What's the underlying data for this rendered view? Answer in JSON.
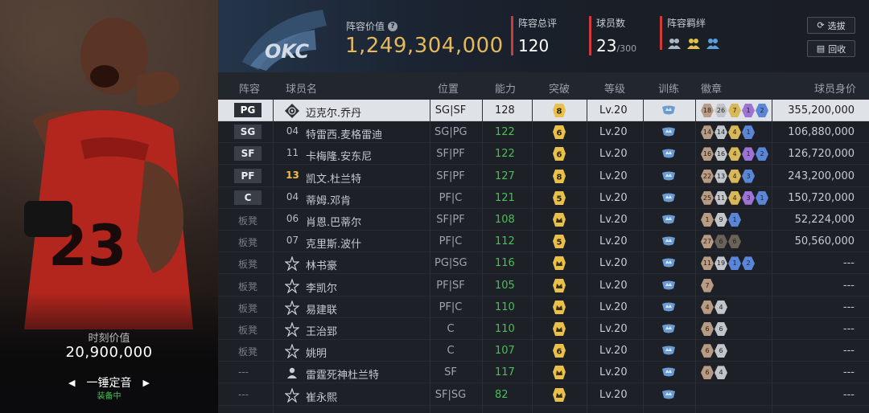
{
  "card": {
    "moment_label": "时刻价值",
    "moment_value": "20,900,000",
    "name": "一锤定音",
    "status": "装备中"
  },
  "header": {
    "lineup_value_label": "阵容价值",
    "lineup_value": "1,249,304,000",
    "rating_label": "阵容总评",
    "rating_value": "120",
    "count_label": "球员数",
    "count_value": "23",
    "count_max": "/300",
    "bond_label": "阵容羁绊",
    "bond_colors": [
      "#a9b6c6",
      "#e2c04a",
      "#5aa0e0"
    ],
    "btn_select": "选拔",
    "btn_recycle": "回收",
    "team_logo_text": "OKC"
  },
  "columns": [
    "阵容",
    "球员名",
    "位置",
    "能力",
    "突破",
    "等级",
    "训练",
    "徽章",
    "球员身价"
  ],
  "rows": [
    {
      "lineup": "PG",
      "starter": true,
      "icon": "clover",
      "num": "",
      "name": "迈克尔.乔丹",
      "pos": "SG|SF",
      "ability": "128",
      "green": false,
      "break": "8",
      "level": "Lv.20",
      "badges": [
        [
          "18",
          "bronze"
        ],
        [
          "26",
          "silver"
        ],
        [
          "7",
          "gold"
        ],
        [
          "1",
          "purple"
        ],
        [
          "2",
          "blue"
        ]
      ],
      "value": "355,200,000",
      "selected": true
    },
    {
      "lineup": "SG",
      "starter": true,
      "icon": "",
      "num": "04",
      "name": "特雷西.麦格雷迪",
      "pos": "SG|PG",
      "ability": "122",
      "green": true,
      "break": "6",
      "level": "Lv.20",
      "badges": [
        [
          "14",
          "bronze"
        ],
        [
          "14",
          "silver"
        ],
        [
          "4",
          "gold"
        ],
        [
          "1",
          "blue"
        ]
      ],
      "value": "106,880,000"
    },
    {
      "lineup": "SF",
      "starter": true,
      "icon": "",
      "num": "11",
      "name": "卡梅隆.安东尼",
      "pos": "SF|PF",
      "ability": "122",
      "green": true,
      "break": "6",
      "level": "Lv.20",
      "badges": [
        [
          "16",
          "bronze"
        ],
        [
          "16",
          "silver"
        ],
        [
          "4",
          "gold"
        ],
        [
          "1",
          "purple"
        ],
        [
          "2",
          "blue"
        ]
      ],
      "value": "126,720,000"
    },
    {
      "lineup": "PF",
      "starter": true,
      "icon": "",
      "num": "13",
      "gold_num": true,
      "name": "凯文.杜兰特",
      "pos": "SF|PF",
      "ability": "127",
      "green": true,
      "break": "8",
      "level": "Lv.20",
      "badges": [
        [
          "22",
          "bronze"
        ],
        [
          "13",
          "silver"
        ],
        [
          "4",
          "gold"
        ],
        [
          "3",
          "blue"
        ]
      ],
      "value": "243,200,000"
    },
    {
      "lineup": "C",
      "starter": true,
      "icon": "",
      "num": "04",
      "name": "蒂姆.邓肯",
      "pos": "PF|C",
      "ability": "121",
      "green": true,
      "break": "5",
      "level": "Lv.20",
      "badges": [
        [
          "25",
          "bronze"
        ],
        [
          "11",
          "silver"
        ],
        [
          "4",
          "gold"
        ],
        [
          "3",
          "purple"
        ],
        [
          "1",
          "blue"
        ]
      ],
      "value": "150,720,000"
    },
    {
      "lineup": "板凳",
      "starter": false,
      "icon": "",
      "num": "06",
      "name": "肖恩.巴蒂尔",
      "pos": "SF|PF",
      "ability": "108",
      "green": true,
      "break": "crown",
      "level": "Lv.20",
      "badges": [
        [
          "1",
          "bronze"
        ],
        [
          "9",
          "silver"
        ],
        [
          "1",
          "blue"
        ]
      ],
      "value": "52,224,000"
    },
    {
      "lineup": "板凳",
      "starter": false,
      "icon": "",
      "num": "07",
      "name": "克里斯.波什",
      "pos": "PF|C",
      "ability": "112",
      "green": true,
      "break": "5",
      "level": "Lv.20",
      "badges": [
        [
          "27",
          "bronze"
        ],
        [
          "6",
          "dark"
        ],
        [
          "6",
          "dark"
        ]
      ],
      "value": "50,560,000"
    },
    {
      "lineup": "板凳",
      "starter": false,
      "icon": "star",
      "num": "",
      "name": "林书豪",
      "pos": "PG|SG",
      "ability": "116",
      "green": true,
      "break": "crown",
      "level": "Lv.20",
      "badges": [
        [
          "11",
          "bronze"
        ],
        [
          "19",
          "silver"
        ],
        [
          "1",
          "blue"
        ],
        [
          "2",
          "blue"
        ]
      ],
      "value": "---"
    },
    {
      "lineup": "板凳",
      "starter": false,
      "icon": "star",
      "num": "",
      "name": "李凯尔",
      "pos": "PF|SF",
      "ability": "105",
      "green": true,
      "break": "crown",
      "level": "Lv.20",
      "badges": [
        [
          "7",
          "bronze"
        ]
      ],
      "value": "---"
    },
    {
      "lineup": "板凳",
      "starter": false,
      "icon": "star",
      "num": "",
      "name": "易建联",
      "pos": "PF|C",
      "ability": "110",
      "green": true,
      "break": "crown",
      "level": "Lv.20",
      "badges": [
        [
          "4",
          "bronze"
        ],
        [
          "4",
          "silver"
        ]
      ],
      "value": "---"
    },
    {
      "lineup": "板凳",
      "starter": false,
      "icon": "star",
      "num": "",
      "name": "王治郅",
      "pos": "C",
      "ability": "110",
      "green": true,
      "break": "crown",
      "level": "Lv.20",
      "badges": [
        [
          "6",
          "bronze"
        ],
        [
          "6",
          "silver"
        ]
      ],
      "value": "---"
    },
    {
      "lineup": "板凳",
      "starter": false,
      "icon": "star",
      "num": "",
      "name": "姚明",
      "pos": "C",
      "ability": "107",
      "green": true,
      "break": "6",
      "level": "Lv.20",
      "badges": [
        [
          "6",
          "bronze"
        ],
        [
          "6",
          "silver"
        ]
      ],
      "value": "---"
    },
    {
      "lineup": "---",
      "starter": false,
      "icon": "avatar",
      "num": "",
      "name": "雷霆死神杜兰特",
      "pos": "SF",
      "ability": "117",
      "green": true,
      "break": "crown",
      "level": "Lv.20",
      "badges": [
        [
          "6",
          "bronze"
        ],
        [
          "4",
          "silver"
        ]
      ],
      "value": "---"
    },
    {
      "lineup": "---",
      "starter": false,
      "icon": "star",
      "num": "",
      "name": "崔永熙",
      "pos": "SF|SG",
      "ability": "82",
      "green": true,
      "break": "crown",
      "level": "Lv.20",
      "badges": [],
      "value": "---"
    }
  ]
}
